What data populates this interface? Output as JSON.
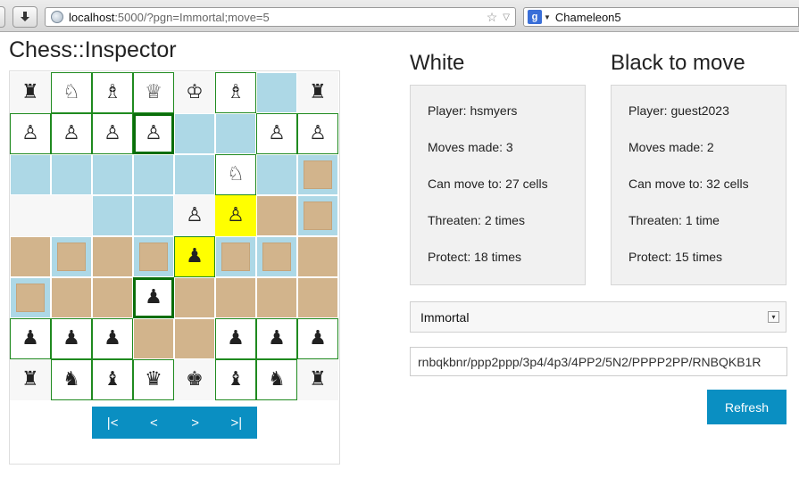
{
  "browser": {
    "url_host": "localhost",
    "url_rest": ":5000/?pgn=Immortal;move=5",
    "search_engine_text": "Chameleon5"
  },
  "page": {
    "title": "Chess::Inspector"
  },
  "board": {
    "squares": [
      [
        {
          "piece": "♜",
          "bg": "empty",
          "border": "none"
        },
        {
          "piece": "♘",
          "bg": "white",
          "border": "green"
        },
        {
          "piece": "♗",
          "bg": "white",
          "border": "green"
        },
        {
          "piece": "♕",
          "bg": "white",
          "border": "green"
        },
        {
          "piece": "♔",
          "bg": "empty",
          "border": "none"
        },
        {
          "piece": "♗",
          "bg": "white",
          "border": "green"
        },
        {
          "piece": "",
          "bg": "blue",
          "border": "white"
        },
        {
          "piece": "♜",
          "bg": "empty",
          "border": "none"
        }
      ],
      [
        {
          "piece": "♙",
          "bg": "white",
          "border": "green"
        },
        {
          "piece": "♙",
          "bg": "white",
          "border": "green"
        },
        {
          "piece": "♙",
          "bg": "white",
          "border": "green"
        },
        {
          "piece": "♙",
          "bg": "white",
          "border": "dkgreen"
        },
        {
          "piece": "",
          "bg": "blue",
          "border": "white"
        },
        {
          "piece": "",
          "bg": "blue",
          "border": "white"
        },
        {
          "piece": "♙",
          "bg": "white",
          "border": "green"
        },
        {
          "piece": "♙",
          "bg": "white",
          "border": "green"
        }
      ],
      [
        {
          "piece": "",
          "bg": "blue",
          "border": "white"
        },
        {
          "piece": "",
          "bg": "blue",
          "border": "white"
        },
        {
          "piece": "",
          "bg": "blue",
          "border": "white"
        },
        {
          "piece": "",
          "bg": "blue",
          "border": "white"
        },
        {
          "piece": "",
          "bg": "blue",
          "border": "white"
        },
        {
          "piece": "♘",
          "bg": "white",
          "border": "green"
        },
        {
          "piece": "",
          "bg": "blue",
          "border": "white"
        },
        {
          "piece": "",
          "bg": "blue",
          "border": "white",
          "inner": true
        }
      ],
      [
        {
          "piece": "",
          "bg": "empty",
          "border": "none"
        },
        {
          "piece": "",
          "bg": "empty",
          "border": "none"
        },
        {
          "piece": "",
          "bg": "blue",
          "border": "white"
        },
        {
          "piece": "",
          "bg": "blue",
          "border": "white"
        },
        {
          "piece": "♙",
          "bg": "empty",
          "border": "none"
        },
        {
          "piece": "♙",
          "bg": "yellow",
          "border": "none"
        },
        {
          "piece": "",
          "bg": "tan",
          "border": "white"
        },
        {
          "piece": "",
          "bg": "blue",
          "border": "white",
          "inner": true
        }
      ],
      [
        {
          "piece": "",
          "bg": "tan",
          "border": "white"
        },
        {
          "piece": "",
          "bg": "blue",
          "border": "white",
          "inner": true
        },
        {
          "piece": "",
          "bg": "tan",
          "border": "white"
        },
        {
          "piece": "",
          "bg": "blue",
          "border": "white",
          "inner": true
        },
        {
          "piece": "♟",
          "bg": "yellow",
          "border": "green"
        },
        {
          "piece": "",
          "bg": "blue",
          "border": "white",
          "inner": true
        },
        {
          "piece": "",
          "bg": "blue",
          "border": "white",
          "inner": true
        },
        {
          "piece": "",
          "bg": "tan",
          "border": "white"
        }
      ],
      [
        {
          "piece": "",
          "bg": "blue",
          "border": "white",
          "inner": true
        },
        {
          "piece": "",
          "bg": "tan",
          "border": "white"
        },
        {
          "piece": "",
          "bg": "tan",
          "border": "white"
        },
        {
          "piece": "♟",
          "bg": "white",
          "border": "dkgreen"
        },
        {
          "piece": "",
          "bg": "tan",
          "border": "white"
        },
        {
          "piece": "",
          "bg": "tan",
          "border": "white"
        },
        {
          "piece": "",
          "bg": "tan",
          "border": "white"
        },
        {
          "piece": "",
          "bg": "tan",
          "border": "white"
        }
      ],
      [
        {
          "piece": "♟",
          "bg": "white",
          "border": "green"
        },
        {
          "piece": "♟",
          "bg": "white",
          "border": "green"
        },
        {
          "piece": "♟",
          "bg": "white",
          "border": "green"
        },
        {
          "piece": "",
          "bg": "tan",
          "border": "white"
        },
        {
          "piece": "",
          "bg": "tan",
          "border": "white"
        },
        {
          "piece": "♟",
          "bg": "white",
          "border": "green"
        },
        {
          "piece": "♟",
          "bg": "white",
          "border": "green"
        },
        {
          "piece": "♟",
          "bg": "white",
          "border": "green"
        }
      ],
      [
        {
          "piece": "♜",
          "bg": "empty",
          "border": "none"
        },
        {
          "piece": "♞",
          "bg": "white",
          "border": "green"
        },
        {
          "piece": "♝",
          "bg": "white",
          "border": "green"
        },
        {
          "piece": "♛",
          "bg": "white",
          "border": "green"
        },
        {
          "piece": "♚",
          "bg": "empty",
          "border": "none"
        },
        {
          "piece": "♝",
          "bg": "white",
          "border": "green"
        },
        {
          "piece": "♞",
          "bg": "white",
          "border": "green"
        },
        {
          "piece": "♜",
          "bg": "empty",
          "border": "none"
        }
      ]
    ]
  },
  "pager": {
    "first": "|<",
    "prev": "<",
    "next": ">",
    "last": ">|"
  },
  "white": {
    "title": "White",
    "player": "Player: hsmyers",
    "moves": "Moves made: 3",
    "can_move": "Can move to: 27 cells",
    "threaten": "Threaten: 2 times",
    "protect": "Protect: 18 times"
  },
  "black": {
    "title": "Black to move",
    "player": "Player: guest2023",
    "moves": "Moves made: 2",
    "can_move": "Can move to: 32 cells",
    "threaten": "Threaten: 1 time",
    "protect": "Protect: 15 times"
  },
  "game_select": {
    "value": "Immortal"
  },
  "fen": {
    "value": "rnbqkbnr/ppp2ppp/3p4/4p3/4PP2/5N2/PPPP2PP/RNBQKB1R"
  },
  "refresh": {
    "label": "Refresh"
  },
  "colors": {
    "blue": "#add8e6",
    "tan": "#d2b48c",
    "yellow": "#ffff00",
    "accent": "#0a8fc2",
    "green": "#1f8a1f"
  }
}
